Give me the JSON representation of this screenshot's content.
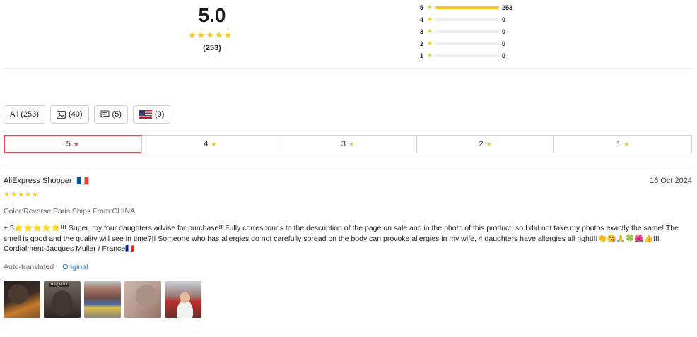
{
  "summary": {
    "score": "5.0",
    "count_label": "(253)",
    "star_color": "#f7c31c",
    "distribution": [
      {
        "stars": "5",
        "count": "253",
        "fraction": 1.0
      },
      {
        "stars": "4",
        "count": "0",
        "fraction": 0
      },
      {
        "stars": "3",
        "count": "0",
        "fraction": 0
      },
      {
        "stars": "2",
        "count": "0",
        "fraction": 0
      },
      {
        "stars": "1",
        "count": "0",
        "fraction": 0
      }
    ]
  },
  "filters": {
    "all": "All (253)",
    "photos_icon": "image-icon",
    "photos": "(40)",
    "comments_icon": "comment-icon",
    "comments": "(5)",
    "country_icon": "us-flag-icon",
    "country": "(9)"
  },
  "star_tabs": {
    "active_color": "#e94b57",
    "items": [
      {
        "label": "5",
        "active": true
      },
      {
        "label": "4",
        "active": false
      },
      {
        "label": "3",
        "active": false
      },
      {
        "label": "2",
        "active": false
      },
      {
        "label": "1",
        "active": false
      }
    ]
  },
  "review": {
    "author": "AliExpress Shopper",
    "author_flag": "fr-flag-icon",
    "date": "16 Oct 2024",
    "rating": 5,
    "variant": "Color:Reverse Paris Ships From:CHINA",
    "text": "+ 5⭐⭐⭐⭐⭐!!! Super, my four daughters advise for purchase!! Fully corresponds to the description of the page on sale and in the photo of this product, so I did not take my photos exactly the same! The smell is good and the quality will see in time?!! Someone who has allergies do not carefully spread on the body can provoke allergies in my wife, 4 daughters have allergies all right!!!👏😘🙏🍀🌺👍!!! Cordialment-Jacques Muller / France🇫🇷",
    "translated_label": "Auto-translated",
    "original_label": "Original",
    "link_color": "#1a7fd0",
    "photo_tag": "rouge for"
  }
}
